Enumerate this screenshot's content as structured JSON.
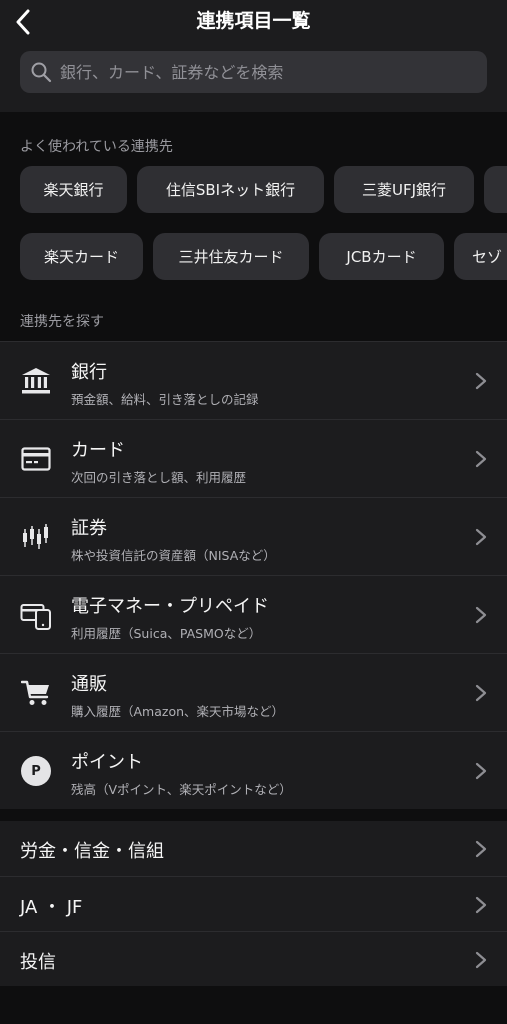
{
  "header": {
    "title": "連携項目一覧",
    "back_icon": "chevron-left-icon"
  },
  "search": {
    "placeholder": "銀行、カード、証券などを検索",
    "value": ""
  },
  "popular": {
    "label": "よく使われている連携先",
    "row1": [
      "楽天銀行",
      "住信SBIネット銀行",
      "三菱UFJ銀行",
      ""
    ],
    "row2": [
      "楽天カード",
      "三井住友カード",
      "JCBカード",
      "セゾ"
    ]
  },
  "browse": {
    "label": "連携先を探す",
    "items": [
      {
        "title": "銀行",
        "subtitle": "預金額、給料、引き落としの記録",
        "icon": "bank-icon"
      },
      {
        "title": "カード",
        "subtitle": "次回の引き落とし額、利用履歴",
        "icon": "credit-card-icon"
      },
      {
        "title": "証券",
        "subtitle": "株や投資信託の資産額（NISAなど）",
        "icon": "candlestick-icon"
      },
      {
        "title": "電子マネー・プリペイド",
        "subtitle": "利用履歴（Suica、PASMOなど）",
        "icon": "e-money-icon"
      },
      {
        "title": "通販",
        "subtitle": "購入履歴（Amazon、楽天市場など）",
        "icon": "shopping-cart-icon"
      },
      {
        "title": "ポイント",
        "subtitle": "残高（Vポイント、楽天ポイントなど）",
        "icon": "point-icon",
        "badge": "P"
      }
    ]
  },
  "other": {
    "items": [
      {
        "title": "労金・信金・信組"
      },
      {
        "title": "JA ・ JF"
      },
      {
        "title": "投信"
      }
    ]
  },
  "colors": {
    "background": "#0e0e0f",
    "surface": "#1c1c1e",
    "chip": "#2f2f33",
    "text": "#f5f5f5",
    "muted": "#9a9aa0"
  }
}
